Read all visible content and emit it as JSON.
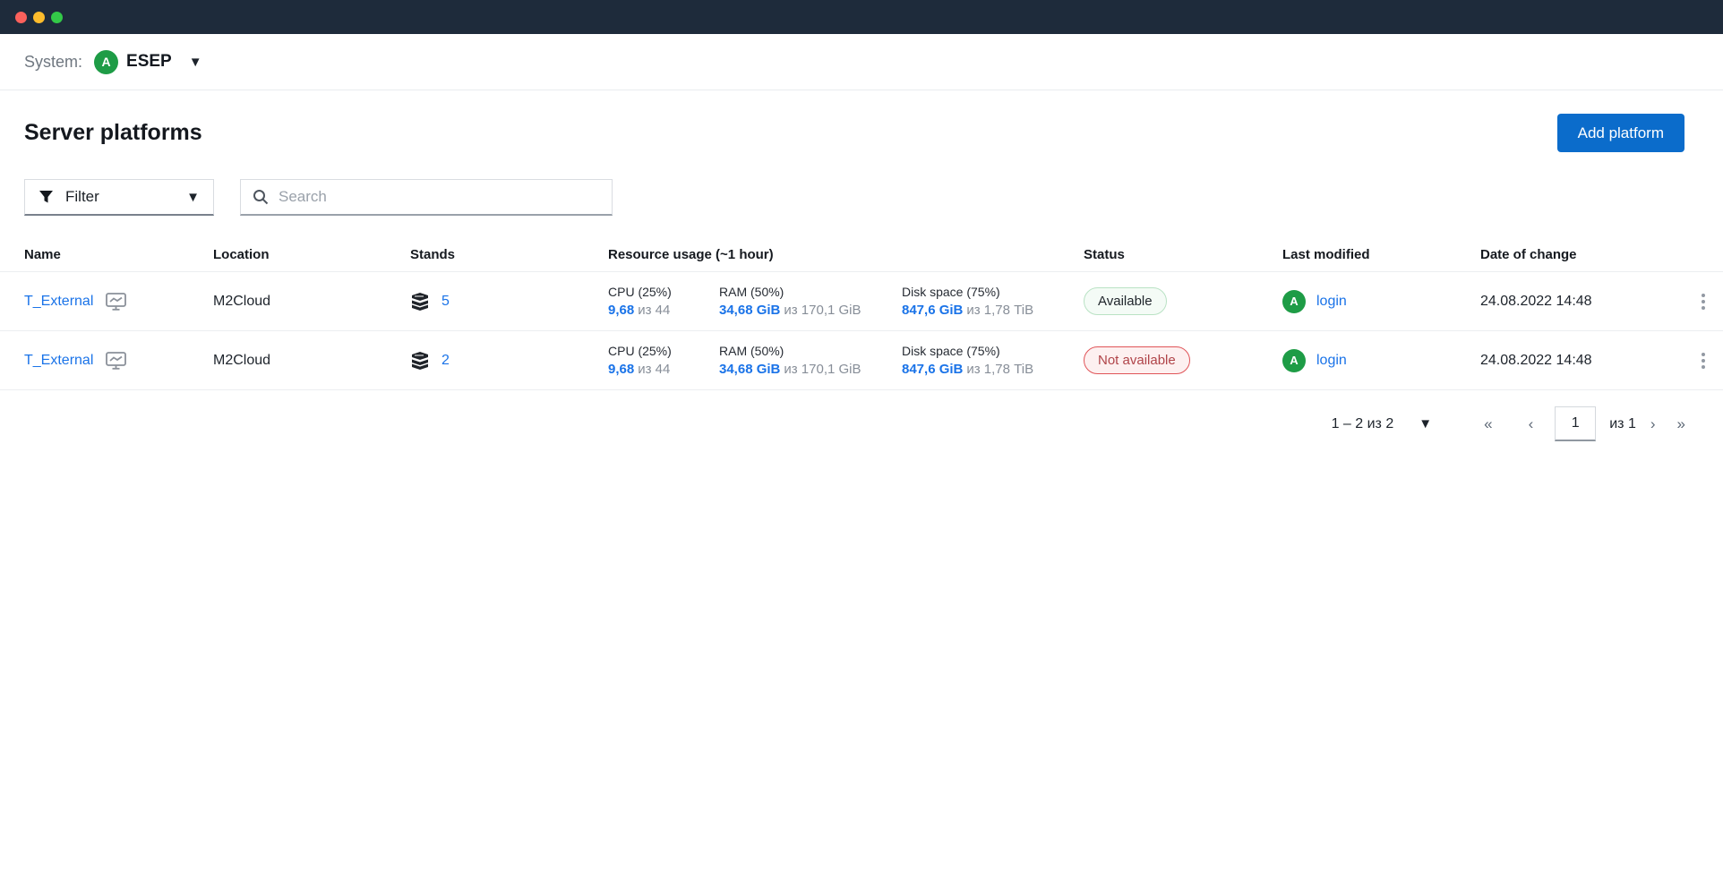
{
  "titlebar": {
    "traffic_lights": {
      "close": "#fb615c",
      "minimize": "#fdbc2c",
      "zoom": "#33c948"
    }
  },
  "system_bar": {
    "label": "System:",
    "avatar_initial": "A",
    "system_name": "ESEP",
    "caret": "▼"
  },
  "page": {
    "title": "Server platforms",
    "add_button_label": "Add platform"
  },
  "toolbar": {
    "filter_label": "Filter",
    "filter_caret": "▼",
    "search_placeholder": "Search"
  },
  "table": {
    "columns": {
      "name": "Name",
      "location": "Location",
      "stands": "Stands",
      "resource": "Resource usage (~1 hour)",
      "status": "Status",
      "last_modified": "Last modified",
      "date_of_change": "Date of change"
    },
    "rows": [
      {
        "name": "T_External",
        "location": "M2Cloud",
        "stands": "5",
        "cpu_label": "CPU (25%)",
        "cpu_value": "9,68",
        "cpu_total": "из 44",
        "ram_label": "RAM (50%)",
        "ram_value": "34,68 GiB",
        "ram_total": "из 170,1 GiB",
        "disk_label": "Disk space (75%)",
        "disk_value": "847,6 GiB",
        "disk_total": "из 1,78 TiB",
        "status": "Available",
        "modified_avatar": "A",
        "modified_user": "login",
        "date": "24.08.2022 14:48"
      },
      {
        "name": "T_External",
        "location": "M2Cloud",
        "stands": "2",
        "cpu_label": "CPU (25%)",
        "cpu_value": "9,68",
        "cpu_total": "из 44",
        "ram_label": "RAM (50%)",
        "ram_value": "34,68 GiB",
        "ram_total": "из 170,1 GiB",
        "disk_label": "Disk space (75%)",
        "disk_value": "847,6 GiB",
        "disk_total": "из 1,78 TiB",
        "status": "Not available",
        "modified_avatar": "A",
        "modified_user": "login",
        "date": "24.08.2022 14:48"
      }
    ]
  },
  "pagination": {
    "range_label": "1 – 2 из 2",
    "range_caret": "▼",
    "first": "«",
    "prev": "‹",
    "page_value": "1",
    "total_label": "из 1",
    "next": "›",
    "last": "»"
  },
  "colors": {
    "titlebar": "#1e2b3b",
    "accent_blue": "#0b6ccb",
    "link_blue": "#1a73e8",
    "avatar_green": "#1e9c46",
    "available_border": "#b9e2c4",
    "not_available_border": "#e05458"
  }
}
